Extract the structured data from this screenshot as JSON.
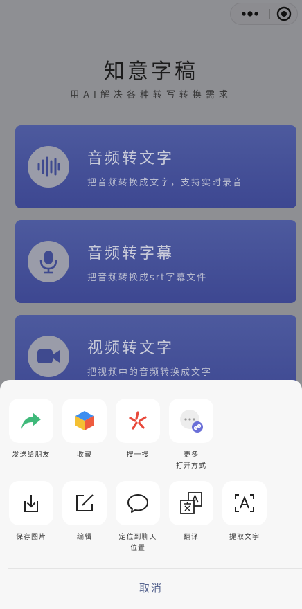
{
  "app": {
    "title": "知意字稿",
    "subtitle": "用AI解决各种转写转换需求"
  },
  "capsule": {
    "more_icon": "more-dots-icon",
    "close_icon": "miniapp-close-icon"
  },
  "cards": [
    {
      "title": "音频转文字",
      "desc": "把音频转换成文字，支持实时录音",
      "icon": "audio-wave-icon"
    },
    {
      "title": "音频转字幕",
      "desc": "把音频转换成srt字幕文件",
      "icon": "microphone-icon"
    },
    {
      "title": "视频转文字",
      "desc": "把视频中的音频转换成文字",
      "icon": "video-camera-icon"
    }
  ],
  "share_sheet": {
    "row1": [
      {
        "label": "发送给朋友",
        "icon": "share-arrow-icon"
      },
      {
        "label": "收藏",
        "icon": "favorite-cube-icon"
      },
      {
        "label": "搜一搜",
        "icon": "search-spark-icon"
      },
      {
        "label": "更多\n打开方式",
        "icon": "more-open-icon"
      }
    ],
    "row2": [
      {
        "label": "保存图片",
        "icon": "download-icon"
      },
      {
        "label": "编辑",
        "icon": "edit-icon"
      },
      {
        "label": "定位到聊天\n位置",
        "icon": "chat-bubble-icon"
      },
      {
        "label": "翻译",
        "icon": "translate-icon"
      },
      {
        "label": "提取文字",
        "icon": "extract-text-icon"
      }
    ],
    "cancel_label": "取消"
  },
  "colors": {
    "card_bg": "#4250a0",
    "share_green": "#3fb97a",
    "cancel_text": "#56648f",
    "sheet_bg": "#f7f7f7"
  }
}
